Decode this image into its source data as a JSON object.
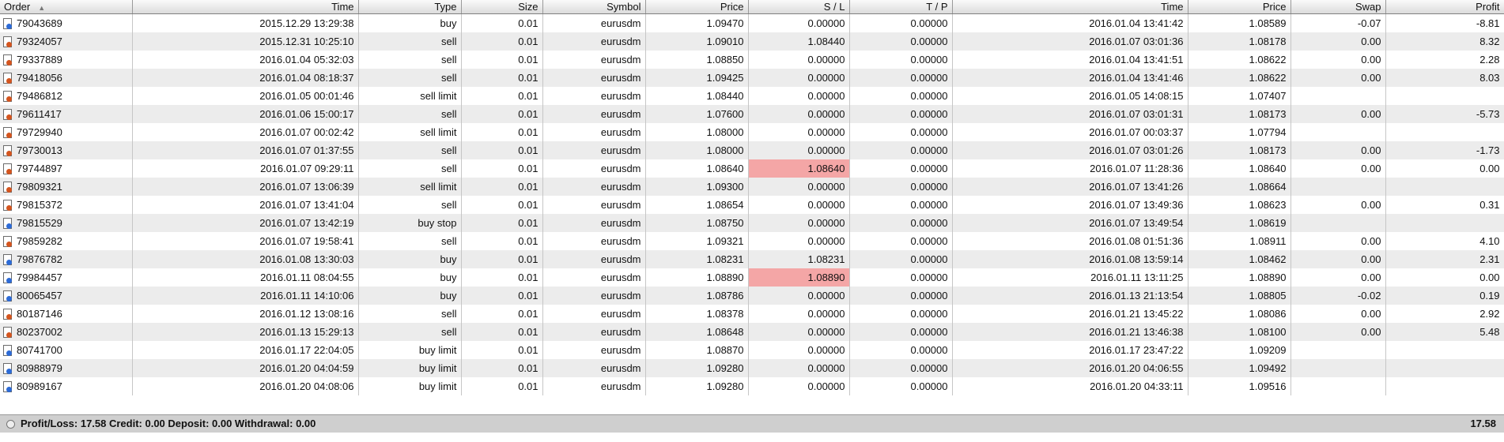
{
  "columns": [
    "Order",
    "Time",
    "Type",
    "Size",
    "Symbol",
    "Price",
    "S / L",
    "T / P",
    "Time",
    "Price",
    "Swap",
    "Profit"
  ],
  "rows": [
    {
      "order": "79043689",
      "open_time": "2015.12.29 13:29:38",
      "type": "buy",
      "size": "0.01",
      "symbol": "eurusdm",
      "open_price": "1.09470",
      "sl": "0.00000",
      "tp": "0.00000",
      "close_time": "2016.01.04 13:41:42",
      "close_price": "1.08589",
      "swap": "-0.07",
      "profit": "-8.81",
      "icon": "buy",
      "sl_hit": false
    },
    {
      "order": "79324057",
      "open_time": "2015.12.31 10:25:10",
      "type": "sell",
      "size": "0.01",
      "symbol": "eurusdm",
      "open_price": "1.09010",
      "sl": "1.08440",
      "tp": "0.00000",
      "close_time": "2016.01.07 03:01:36",
      "close_price": "1.08178",
      "swap": "0.00",
      "profit": "8.32",
      "icon": "sell",
      "sl_hit": false
    },
    {
      "order": "79337889",
      "open_time": "2016.01.04 05:32:03",
      "type": "sell",
      "size": "0.01",
      "symbol": "eurusdm",
      "open_price": "1.08850",
      "sl": "0.00000",
      "tp": "0.00000",
      "close_time": "2016.01.04 13:41:51",
      "close_price": "1.08622",
      "swap": "0.00",
      "profit": "2.28",
      "icon": "sell",
      "sl_hit": false
    },
    {
      "order": "79418056",
      "open_time": "2016.01.04 08:18:37",
      "type": "sell",
      "size": "0.01",
      "symbol": "eurusdm",
      "open_price": "1.09425",
      "sl": "0.00000",
      "tp": "0.00000",
      "close_time": "2016.01.04 13:41:46",
      "close_price": "1.08622",
      "swap": "0.00",
      "profit": "8.03",
      "icon": "sell",
      "sl_hit": false
    },
    {
      "order": "79486812",
      "open_time": "2016.01.05 00:01:46",
      "type": "sell limit",
      "size": "0.01",
      "symbol": "eurusdm",
      "open_price": "1.08440",
      "sl": "0.00000",
      "tp": "0.00000",
      "close_time": "2016.01.05 14:08:15",
      "close_price": "1.07407",
      "swap": "",
      "profit": "",
      "icon": "sell",
      "sl_hit": false
    },
    {
      "order": "79611417",
      "open_time": "2016.01.06 15:00:17",
      "type": "sell",
      "size": "0.01",
      "symbol": "eurusdm",
      "open_price": "1.07600",
      "sl": "0.00000",
      "tp": "0.00000",
      "close_time": "2016.01.07 03:01:31",
      "close_price": "1.08173",
      "swap": "0.00",
      "profit": "-5.73",
      "icon": "sell",
      "sl_hit": false
    },
    {
      "order": "79729940",
      "open_time": "2016.01.07 00:02:42",
      "type": "sell limit",
      "size": "0.01",
      "symbol": "eurusdm",
      "open_price": "1.08000",
      "sl": "0.00000",
      "tp": "0.00000",
      "close_time": "2016.01.07 00:03:37",
      "close_price": "1.07794",
      "swap": "",
      "profit": "",
      "icon": "sell",
      "sl_hit": false
    },
    {
      "order": "79730013",
      "open_time": "2016.01.07 01:37:55",
      "type": "sell",
      "size": "0.01",
      "symbol": "eurusdm",
      "open_price": "1.08000",
      "sl": "0.00000",
      "tp": "0.00000",
      "close_time": "2016.01.07 03:01:26",
      "close_price": "1.08173",
      "swap": "0.00",
      "profit": "-1.73",
      "icon": "sell",
      "sl_hit": false
    },
    {
      "order": "79744897",
      "open_time": "2016.01.07 09:29:11",
      "type": "sell",
      "size": "0.01",
      "symbol": "eurusdm",
      "open_price": "1.08640",
      "sl": "1.08640",
      "tp": "0.00000",
      "close_time": "2016.01.07 11:28:36",
      "close_price": "1.08640",
      "swap": "0.00",
      "profit": "0.00",
      "icon": "sell",
      "sl_hit": true
    },
    {
      "order": "79809321",
      "open_time": "2016.01.07 13:06:39",
      "type": "sell limit",
      "size": "0.01",
      "symbol": "eurusdm",
      "open_price": "1.09300",
      "sl": "0.00000",
      "tp": "0.00000",
      "close_time": "2016.01.07 13:41:26",
      "close_price": "1.08664",
      "swap": "",
      "profit": "",
      "icon": "sell",
      "sl_hit": false
    },
    {
      "order": "79815372",
      "open_time": "2016.01.07 13:41:04",
      "type": "sell",
      "size": "0.01",
      "symbol": "eurusdm",
      "open_price": "1.08654",
      "sl": "0.00000",
      "tp": "0.00000",
      "close_time": "2016.01.07 13:49:36",
      "close_price": "1.08623",
      "swap": "0.00",
      "profit": "0.31",
      "icon": "sell",
      "sl_hit": false
    },
    {
      "order": "79815529",
      "open_time": "2016.01.07 13:42:19",
      "type": "buy stop",
      "size": "0.01",
      "symbol": "eurusdm",
      "open_price": "1.08750",
      "sl": "0.00000",
      "tp": "0.00000",
      "close_time": "2016.01.07 13:49:54",
      "close_price": "1.08619",
      "swap": "",
      "profit": "",
      "icon": "buy",
      "sl_hit": false
    },
    {
      "order": "79859282",
      "open_time": "2016.01.07 19:58:41",
      "type": "sell",
      "size": "0.01",
      "symbol": "eurusdm",
      "open_price": "1.09321",
      "sl": "0.00000",
      "tp": "0.00000",
      "close_time": "2016.01.08 01:51:36",
      "close_price": "1.08911",
      "swap": "0.00",
      "profit": "4.10",
      "icon": "sell",
      "sl_hit": false
    },
    {
      "order": "79876782",
      "open_time": "2016.01.08 13:30:03",
      "type": "buy",
      "size": "0.01",
      "symbol": "eurusdm",
      "open_price": "1.08231",
      "sl": "1.08231",
      "tp": "0.00000",
      "close_time": "2016.01.08 13:59:14",
      "close_price": "1.08462",
      "swap": "0.00",
      "profit": "2.31",
      "icon": "buy",
      "sl_hit": false
    },
    {
      "order": "79984457",
      "open_time": "2016.01.11 08:04:55",
      "type": "buy",
      "size": "0.01",
      "symbol": "eurusdm",
      "open_price": "1.08890",
      "sl": "1.08890",
      "tp": "0.00000",
      "close_time": "2016.01.11 13:11:25",
      "close_price": "1.08890",
      "swap": "0.00",
      "profit": "0.00",
      "icon": "buy",
      "sl_hit": true
    },
    {
      "order": "80065457",
      "open_time": "2016.01.11 14:10:06",
      "type": "buy",
      "size": "0.01",
      "symbol": "eurusdm",
      "open_price": "1.08786",
      "sl": "0.00000",
      "tp": "0.00000",
      "close_time": "2016.01.13 21:13:54",
      "close_price": "1.08805",
      "swap": "-0.02",
      "profit": "0.19",
      "icon": "buy",
      "sl_hit": false
    },
    {
      "order": "80187146",
      "open_time": "2016.01.12 13:08:16",
      "type": "sell",
      "size": "0.01",
      "symbol": "eurusdm",
      "open_price": "1.08378",
      "sl": "0.00000",
      "tp": "0.00000",
      "close_time": "2016.01.21 13:45:22",
      "close_price": "1.08086",
      "swap": "0.00",
      "profit": "2.92",
      "icon": "sell",
      "sl_hit": false
    },
    {
      "order": "80237002",
      "open_time": "2016.01.13 15:29:13",
      "type": "sell",
      "size": "0.01",
      "symbol": "eurusdm",
      "open_price": "1.08648",
      "sl": "0.00000",
      "tp": "0.00000",
      "close_time": "2016.01.21 13:46:38",
      "close_price": "1.08100",
      "swap": "0.00",
      "profit": "5.48",
      "icon": "sell",
      "sl_hit": false
    },
    {
      "order": "80741700",
      "open_time": "2016.01.17 22:04:05",
      "type": "buy limit",
      "size": "0.01",
      "symbol": "eurusdm",
      "open_price": "1.08870",
      "sl": "0.00000",
      "tp": "0.00000",
      "close_time": "2016.01.17 23:47:22",
      "close_price": "1.09209",
      "swap": "",
      "profit": "",
      "icon": "buy",
      "sl_hit": false
    },
    {
      "order": "80988979",
      "open_time": "2016.01.20 04:04:59",
      "type": "buy limit",
      "size": "0.01",
      "symbol": "eurusdm",
      "open_price": "1.09280",
      "sl": "0.00000",
      "tp": "0.00000",
      "close_time": "2016.01.20 04:06:55",
      "close_price": "1.09492",
      "swap": "",
      "profit": "",
      "icon": "buy",
      "sl_hit": false
    },
    {
      "order": "80989167",
      "open_time": "2016.01.20 04:08:06",
      "type": "buy limit",
      "size": "0.01",
      "symbol": "eurusdm",
      "open_price": "1.09280",
      "sl": "0.00000",
      "tp": "0.00000",
      "close_time": "2016.01.20 04:33:11",
      "close_price": "1.09516",
      "swap": "",
      "profit": "",
      "icon": "buy",
      "sl_hit": false
    }
  ],
  "summary": {
    "text": "Profit/Loss: 17.58  Credit: 0.00  Deposit: 0.00  Withdrawal: 0.00",
    "total": "17.58"
  },
  "colors": {
    "sl_highlight": "#f4a6a6",
    "row_alt": "#ececec",
    "summary_bg": "#cfcfcf",
    "buy_icon": "#2d6bd6",
    "sell_icon": "#d4551f"
  },
  "icons": {
    "sort": "sort-ascending-icon",
    "buy": "order-buy-icon",
    "sell": "order-sell-icon",
    "summary": "summary-circle-icon"
  }
}
